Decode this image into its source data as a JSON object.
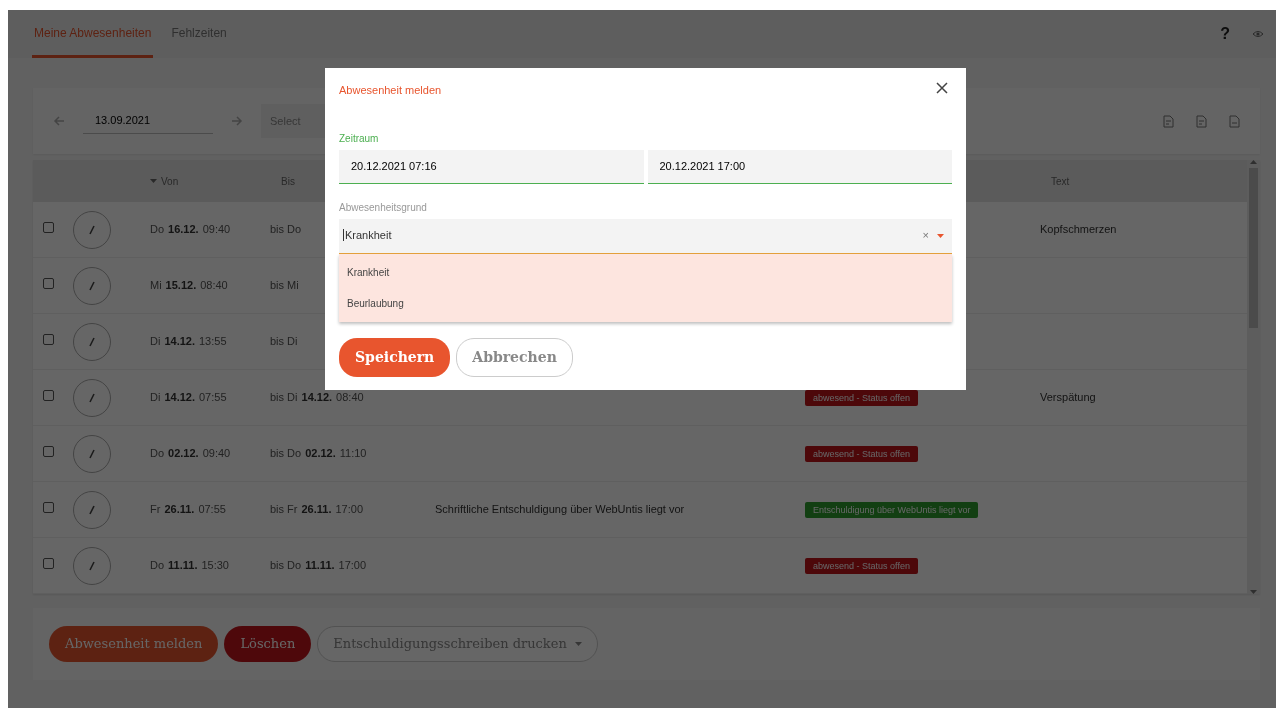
{
  "tabs": [
    {
      "label": "Meine Abwesenheiten",
      "selected": true
    },
    {
      "label": "Fehlzeiten",
      "selected": false
    }
  ],
  "help_label": "?",
  "toolbar": {
    "date": "13.09.2021",
    "select_value": "Select"
  },
  "table": {
    "columns": [
      {
        "label": "Von",
        "sorted": true
      },
      {
        "label": "Bis",
        "sorted": false
      },
      {
        "label": "Text",
        "sorted": false
      }
    ],
    "rows": [
      {
        "checked": false,
        "from": {
          "day": "Do",
          "date": "16.12.",
          "time": "09:40"
        },
        "to": {
          "prefix": "bis Do"
        },
        "text": "Kopfschmerzen"
      },
      {
        "checked": false,
        "from": {
          "day": "Mi",
          "date": "15.12.",
          "time": "08:40"
        },
        "to": {
          "prefix": "bis Mi"
        }
      },
      {
        "checked": false,
        "from": {
          "day": "Di",
          "date": "14.12.",
          "time": "13:55"
        },
        "to": {
          "prefix": "bis Di"
        }
      },
      {
        "checked": false,
        "from": {
          "day": "Di",
          "date": "14.12.",
          "time": "07:55"
        },
        "to": {
          "prefix": "bis Di",
          "date": "14.12.",
          "time": "08:40"
        },
        "status": {
          "kind": "open",
          "label": "abwesend - Status offen"
        },
        "text": "Verspätung"
      },
      {
        "checked": false,
        "from": {
          "day": "Do",
          "date": "02.12.",
          "time": "09:40"
        },
        "to": {
          "prefix": "bis Do",
          "date": "02.12.",
          "time": "11:10"
        },
        "status": {
          "kind": "open",
          "label": "abwesend - Status offen"
        }
      },
      {
        "checked": false,
        "from": {
          "day": "Fr",
          "date": "26.11.",
          "time": "07:55"
        },
        "to": {
          "prefix": "bis Fr",
          "date": "26.11.",
          "time": "17:00"
        },
        "note": "Schriftliche Entschuldigung über WebUntis liegt vor",
        "status": {
          "kind": "excused",
          "label": "Entschuldigung über WebUntis liegt vor"
        }
      },
      {
        "checked": false,
        "from": {
          "day": "Do",
          "date": "11.11.",
          "time": "15:30"
        },
        "to": {
          "prefix": "bis Do",
          "date": "11.11.",
          "time": "17:00"
        },
        "status": {
          "kind": "open",
          "label": "abwesend - Status offen"
        }
      }
    ]
  },
  "footer_buttons": [
    {
      "label": "Abwesenheit melden",
      "kind": "primary"
    },
    {
      "label": "Löschen",
      "kind": "danger"
    },
    {
      "label": "Entschuldigungsschreiben drucken",
      "kind": "dropdown"
    }
  ],
  "modal": {
    "title": "Abwesenheit melden",
    "period_label": "Zeitraum",
    "start": "20.12.2021 07:16",
    "end": "20.12.2021 17:00",
    "reason_label": "Abwesenheitsgrund",
    "reason_value": "Krankheit",
    "clear_label": "×",
    "options": [
      "Krankheit",
      "Beurlaubung"
    ],
    "buttons": [
      {
        "label": "Speichern",
        "kind": "primary"
      },
      {
        "label": "Abbrechen",
        "kind": "outline"
      }
    ]
  }
}
